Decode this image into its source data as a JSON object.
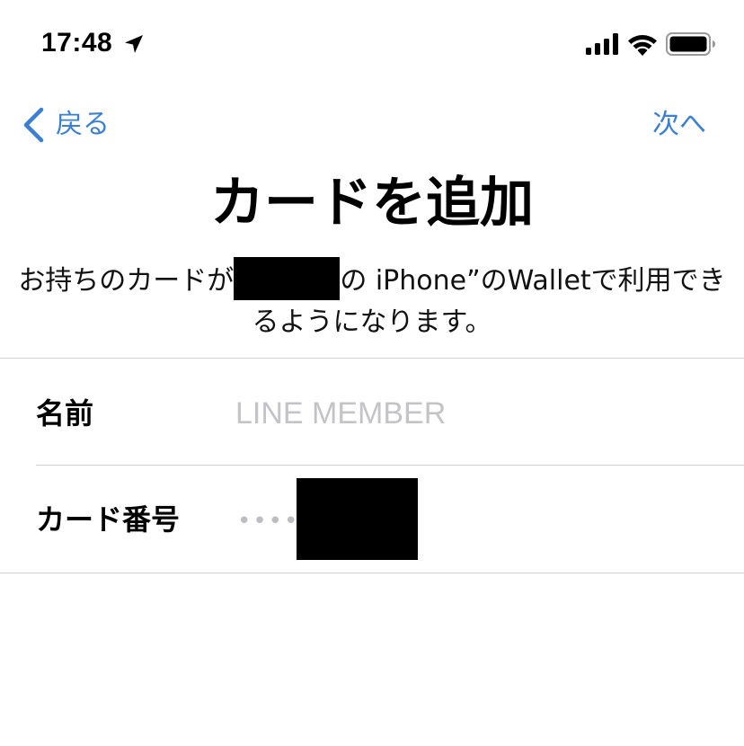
{
  "status_bar": {
    "time": "17:48"
  },
  "nav": {
    "back_label": "戻る",
    "next_label": "次へ"
  },
  "title": "カードを追加",
  "description": {
    "prefix": "お持ちのカードが",
    "suffix": "の iPhone”のWalletで利用できるようになります。"
  },
  "form": {
    "name_label": "名前",
    "name_placeholder": "LINE MEMBER",
    "card_number_label": "カード番号",
    "card_number_masked": "••••"
  },
  "colors": {
    "accent": "#3a7fd5",
    "placeholder": "#c4c4c8",
    "divider": "#cfcfd3"
  },
  "icons": [
    "location-arrow-icon",
    "cellular-signal-icon",
    "wifi-icon",
    "battery-icon",
    "chevron-left-icon"
  ]
}
